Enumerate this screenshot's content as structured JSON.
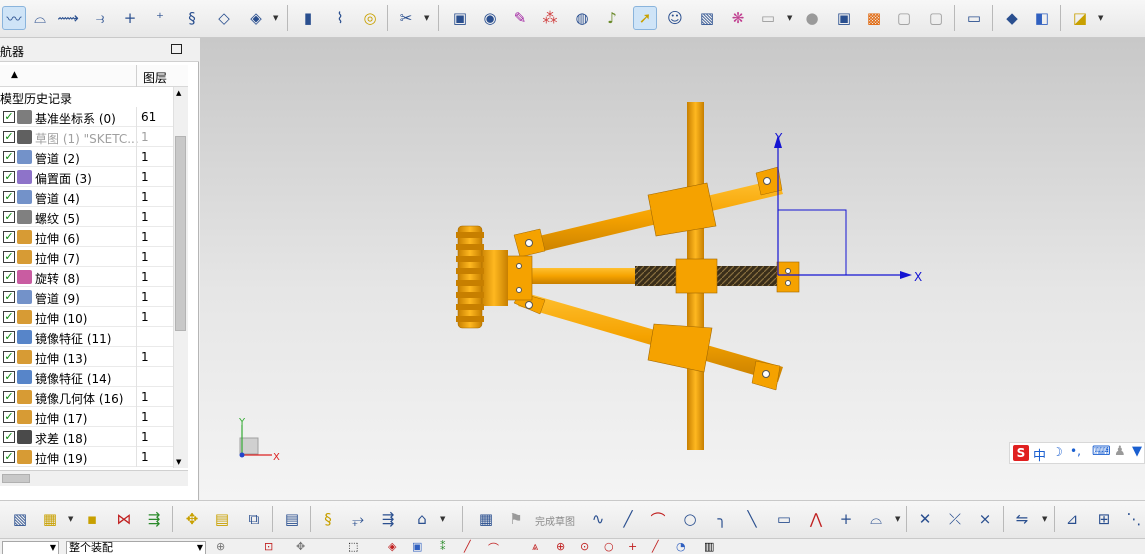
{
  "navigator": {
    "title": "航器",
    "column_name": "",
    "column_layer": "图层",
    "group_label": "模型历史记录",
    "rows": [
      {
        "label": "基准坐标系 (0)",
        "layer": "61",
        "icon": "datum-csys-icon"
      },
      {
        "label": "草图 (1) \"SKETC...",
        "layer": "1",
        "icon": "sketch-icon"
      },
      {
        "label": "管道 (2)",
        "layer": "1",
        "icon": "tube-icon"
      },
      {
        "label": "偏置面 (3)",
        "layer": "1",
        "icon": "offset-face-icon"
      },
      {
        "label": "管道 (4)",
        "layer": "1",
        "icon": "tube-icon"
      },
      {
        "label": "螺纹 (5)",
        "layer": "1",
        "icon": "thread-icon"
      },
      {
        "label": "拉伸 (6)",
        "layer": "1",
        "icon": "extrude-icon"
      },
      {
        "label": "拉伸 (7)",
        "layer": "1",
        "icon": "extrude-icon"
      },
      {
        "label": "旋转 (8)",
        "layer": "1",
        "icon": "revolve-icon"
      },
      {
        "label": "管道 (9)",
        "layer": "1",
        "icon": "tube-icon"
      },
      {
        "label": "拉伸 (10)",
        "layer": "1",
        "icon": "extrude-icon"
      },
      {
        "label": "镜像特征 (11)",
        "layer": "",
        "icon": "mirror-feature-icon"
      },
      {
        "label": "拉伸 (13)",
        "layer": "1",
        "icon": "extrude-icon"
      },
      {
        "label": "镜像特征 (14)",
        "layer": "",
        "icon": "mirror-feature-icon"
      },
      {
        "label": "镜像几何体 (16)",
        "layer": "1",
        "icon": "mirror-geometry-icon"
      },
      {
        "label": "拉伸 (17)",
        "layer": "1",
        "icon": "extrude-icon"
      },
      {
        "label": "求差 (18)",
        "layer": "1",
        "icon": "subtract-icon"
      },
      {
        "label": "拉伸 (19)",
        "layer": "1",
        "icon": "extrude-icon"
      }
    ]
  },
  "viewport": {
    "csys_labels": {
      "x": "X",
      "y": "Y"
    },
    "triad_labels": {
      "x": "X",
      "y": "Y"
    },
    "ime": {
      "logo": "S",
      "mode": "中"
    }
  },
  "bottom_toolbar": {
    "finish_sketch_label": "完成草图"
  },
  "status_bar": {
    "filter_value": "",
    "scope_value": "整个装配"
  },
  "colors": {
    "part": "#f5a200",
    "part_dark": "#c77f00",
    "thread": "#4a3a22",
    "csys": "#1414d2"
  }
}
